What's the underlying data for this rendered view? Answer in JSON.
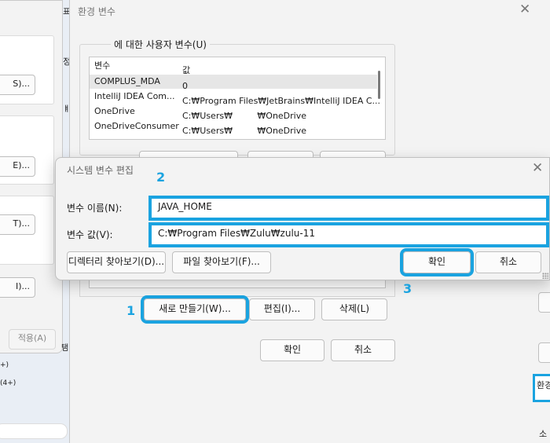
{
  "system_properties": {
    "buttons": [
      "S)...",
      "E)...",
      "T)...",
      "I)..."
    ],
    "apply": "적용(A)",
    "side_glyphs": [
      "표",
      "정",
      "ㅒ",
      "탬"
    ],
    "footnotes": [
      "+)",
      "(4+)"
    ]
  },
  "env_dialog": {
    "title": "환경 변수",
    "close": "✕",
    "user_group_label": "에 대한 사용자 변수(U)",
    "columns": [
      "변수",
      "값"
    ],
    "rows": [
      {
        "name": "COMPLUS_MDA",
        "value": "0"
      },
      {
        "name": "IntelliJ IDEA Com...",
        "value": "C:₩Program Files₩JetBrains₩IntelliJ IDEA C..."
      },
      {
        "name": "OneDrive",
        "value": "C:₩Users₩         ₩OneDrive"
      },
      {
        "name": "OneDriveConsumer",
        "value": "C:₩Users₩         ₩OneDrive"
      }
    ],
    "new_button": "새로 만들기(W)...",
    "edit_button": "편집(I)...",
    "delete_button": "삭제(L)",
    "ok_button": "확인",
    "cancel_button": "취소"
  },
  "edit_dialog": {
    "title": "시스템 변수 편집",
    "close": "✕",
    "name_label": "변수 이름(N):",
    "name_value": "JAVA_HOME",
    "value_label": "변수 값(V):",
    "value_value": "C:₩Program Files₩Zulu₩zulu-11",
    "browse_dir": "디렉터리 찾아보기(D)...",
    "browse_file": "파일 찾아보기(F)...",
    "ok": "확인",
    "cancel": "취소"
  },
  "steps": [
    "1",
    "2",
    "3"
  ],
  "right_strip": {
    "tab": "환경",
    "glyph": "소"
  },
  "colors": {
    "highlight": "#1aa3e0",
    "dialog_bg": "#f3f3f3"
  }
}
